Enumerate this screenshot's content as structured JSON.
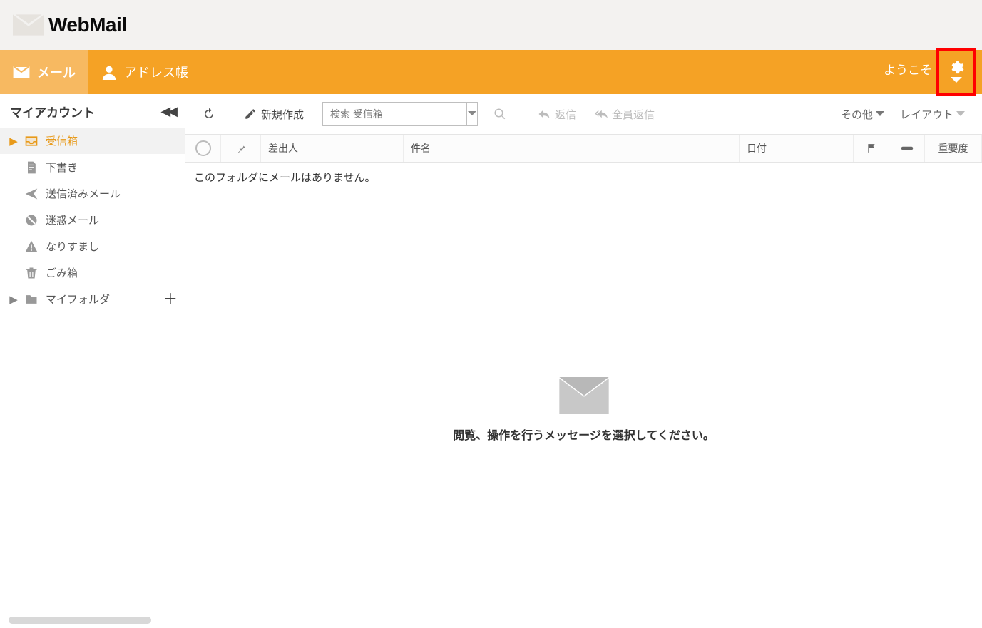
{
  "logo": {
    "title": "WebMail"
  },
  "nav": {
    "mail": "メール",
    "addressbook": "アドレス帳",
    "welcome": "ようこそ"
  },
  "sidebar": {
    "title": "マイアカウント",
    "folders": {
      "inbox": "受信箱",
      "drafts": "下書き",
      "sent": "送信済みメール",
      "spam": "迷惑メール",
      "spoof": "なりすまし",
      "trash": "ごみ箱",
      "myfolder": "マイフォルダ"
    }
  },
  "toolbar": {
    "compose": "新規作成",
    "search_placeholder": "検索 受信箱",
    "reply": "返信",
    "reply_all": "全員返信",
    "other": "その他",
    "layout": "レイアウト"
  },
  "columns": {
    "from": "差出人",
    "subject": "件名",
    "date": "日付",
    "priority": "重要度"
  },
  "messages": {
    "empty_folder": "このフォルダにメールはありません。",
    "select_message": "閲覧、操作を行うメッセージを選択してください。"
  }
}
